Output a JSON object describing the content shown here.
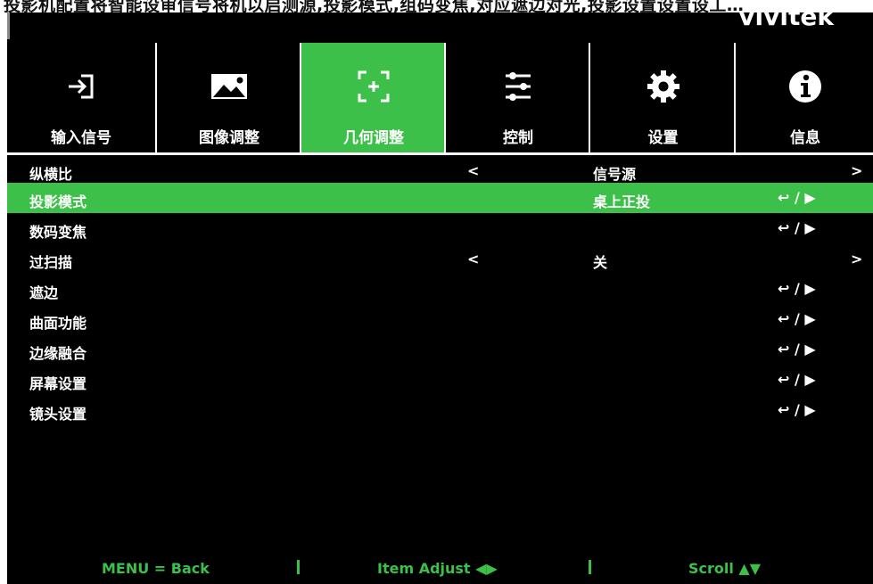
{
  "caption_top": "投影机配置将智能设审信号将机以启测源,投影模式,组码变焦,对应遮边对光,投影设置设置设工…",
  "brand": "vivitek",
  "tabs": [
    {
      "label": "输入信号",
      "icon": "input-icon",
      "active": false
    },
    {
      "label": "图像调整",
      "icon": "image-icon",
      "active": false
    },
    {
      "label": "几何调整",
      "icon": "geometry-icon",
      "active": true
    },
    {
      "label": "控制",
      "icon": "control-sliders-icon",
      "active": false
    },
    {
      "label": "设置",
      "icon": "gear-icon",
      "active": false
    },
    {
      "label": "信息",
      "icon": "info-icon",
      "active": false
    }
  ],
  "rows": [
    {
      "name": "纵横比",
      "left_arrow": "<",
      "value": "信号源",
      "action": "",
      "right_arrow": ">",
      "selected": false
    },
    {
      "name": "投影模式",
      "left_arrow": "",
      "value": "桌上正投",
      "action": "↩ / ▶",
      "right_arrow": "",
      "selected": true
    },
    {
      "name": "数码变焦",
      "left_arrow": "",
      "value": "",
      "action": "↩ / ▶",
      "right_arrow": "",
      "selected": false
    },
    {
      "name": "过扫描",
      "left_arrow": "<",
      "value": "关",
      "action": "",
      "right_arrow": ">",
      "selected": false
    },
    {
      "name": "遮边",
      "left_arrow": "",
      "value": "",
      "action": "↩ / ▶",
      "right_arrow": "",
      "selected": false
    },
    {
      "name": "曲面功能",
      "left_arrow": "",
      "value": "",
      "action": "↩ / ▶",
      "right_arrow": "",
      "selected": false
    },
    {
      "name": "边缘融合",
      "left_arrow": "",
      "value": "",
      "action": "↩ / ▶",
      "right_arrow": "",
      "selected": false
    },
    {
      "name": "屏幕设置",
      "left_arrow": "",
      "value": "",
      "action": "↩ / ▶",
      "right_arrow": "",
      "selected": false
    },
    {
      "name": "镜头设置",
      "left_arrow": "",
      "value": "",
      "action": "↩ / ▶",
      "right_arrow": "",
      "selected": false
    }
  ],
  "footer": {
    "menu": "MENU = Back",
    "item_adjust": "Item Adjust ◀▶",
    "scroll": "Scroll ▲▼"
  },
  "colors": {
    "accent": "#3cc04a",
    "background": "#000000",
    "text": "#ffffff"
  }
}
